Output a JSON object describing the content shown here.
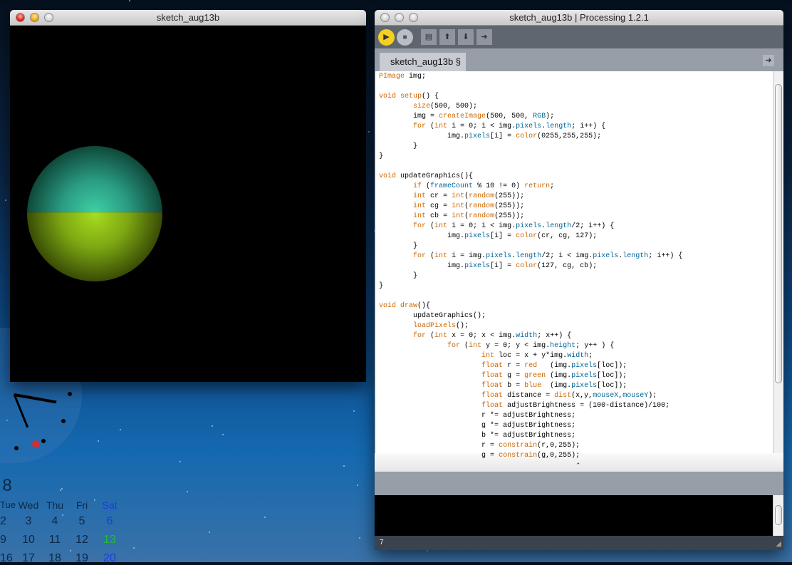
{
  "sketch_window": {
    "title": "sketch_aug13b"
  },
  "ide_window": {
    "title": "sketch_aug13b | Processing 1.2.1",
    "toolbar": {
      "run": "run-icon",
      "stop": "stop-icon",
      "new": "new-icon",
      "open": "open-icon",
      "save": "save-icon",
      "export": "export-icon"
    },
    "tab_label": "sketch_aug13b §",
    "code": [
      "PImage img;",
      "",
      "void setup() {",
      "\tsize(500, 500);",
      "\timg = createImage(500, 500, RGB);",
      "\tfor (int i = 0; i < img.pixels.length; i++) {",
      "\t\timg.pixels[i] = color(0255,255,255);",
      "\t}",
      "}",
      "",
      "void updateGraphics(){",
      "\tif (frameCount % 10 != 0) return;",
      "\tint cr = int(random(255));",
      "\tint cg = int(random(255));",
      "\tint cb = int(random(255));",
      "\tfor (int i = 0; i < img.pixels.length/2; i++) {",
      "\t\timg.pixels[i] = color(cr, cg, 127);",
      "\t}",
      "\tfor (int i = img.pixels.length/2; i < img.pixels.length; i++) {",
      "\t\timg.pixels[i] = color(127, cg, cb);",
      "\t}",
      "}",
      "",
      "void draw(){",
      "\tupdateGraphics();",
      "\tloadPixels();",
      "\tfor (int x = 0; x < img.width; x++) {",
      "\t\tfor (int y = 0; y < img.height; y++ ) {",
      "\t\t\tint loc = x + y*img.width;",
      "\t\t\tfloat r = red   (img.pixels[loc]);",
      "\t\t\tfloat g = green (img.pixels[loc]);",
      "\t\t\tfloat b = blue  (img.pixels[loc]);",
      "\t\t\tfloat distance = dist(x,y,mouseX,mouseY);",
      "\t\t\tfloat adjustBrightness = (100-distance)/100;",
      "\t\t\tr *= adjustBrightness;",
      "\t\t\tg *= adjustBrightness;",
      "\t\t\tb *= adjustBrightness;",
      "\t\t\tr = constrain(r,0,255);",
      "\t\t\tg = constrain(g,0,255);"
    ],
    "status_line": "7",
    "colors": {
      "keyword": "#cc6600",
      "builtin_var": "#006699",
      "run_button": "#f5d020"
    }
  },
  "desktop": {
    "calendar": {
      "month_fragment": "8",
      "weekdays": [
        "Tue",
        "Wed",
        "Thu",
        "Fri",
        "Sat"
      ],
      "rows": [
        [
          "2",
          "3",
          "4",
          "5",
          "6"
        ],
        [
          "9",
          "10",
          "11",
          "12",
          "13"
        ],
        [
          "16",
          "17",
          "18",
          "19",
          "20"
        ]
      ],
      "today": "13",
      "colors": {
        "saturday": "#1a3de0",
        "today": "#22c02a"
      }
    }
  }
}
